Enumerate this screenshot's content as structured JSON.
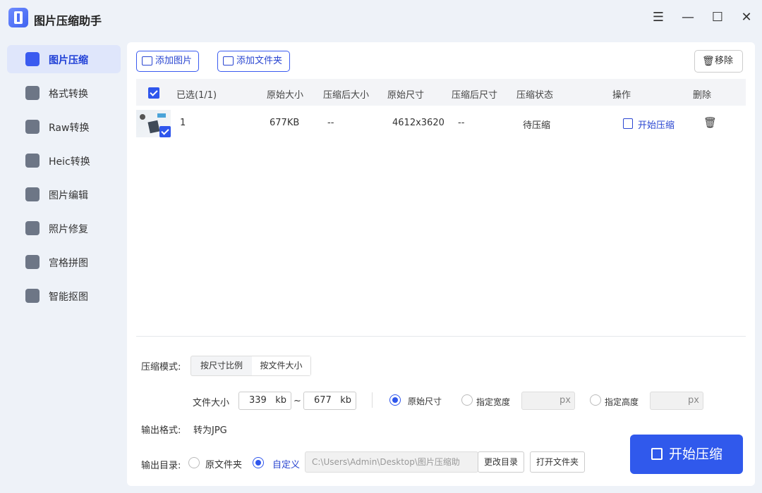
{
  "app": {
    "title": "图片压缩助手"
  },
  "sidebar": {
    "items": [
      {
        "label": "图片压缩"
      },
      {
        "label": "格式转换"
      },
      {
        "label": "Raw转换"
      },
      {
        "label": "Heic转换"
      },
      {
        "label": "图片编辑"
      },
      {
        "label": "照片修复"
      },
      {
        "label": "宫格拼图"
      },
      {
        "label": "智能抠图"
      }
    ]
  },
  "toolbar": {
    "add_image": "添加图片",
    "add_folder": "添加文件夹",
    "remove": "移除"
  },
  "table": {
    "headers": [
      "已选(1/1)",
      "原始大小",
      "压缩后大小",
      "原始尺寸",
      "压缩后尺寸",
      "压缩状态",
      "操作",
      "删除"
    ],
    "rows": [
      {
        "index": "1",
        "orig_size": "677KB",
        "comp_size": "--",
        "orig_dim": "4612x3620",
        "comp_dim": "--",
        "status": "待压缩",
        "action": "开始压缩"
      }
    ]
  },
  "settings": {
    "mode_label": "压缩模式:",
    "mode_options": [
      "按尺寸比例",
      "按文件大小"
    ],
    "filesize_label": "文件大小",
    "min_value": "339",
    "max_value": "677",
    "unit": "kb",
    "tilde": "~",
    "radio_original": "原始尺寸",
    "radio_width": "指定宽度",
    "radio_height": "指定高度",
    "px": "px",
    "format_label": "输出格式:",
    "format_value": "转为JPG",
    "dir_label": "输出目录:",
    "dir_original": "原文件夹",
    "dir_custom": "自定义",
    "path_value": "C:\\Users\\Admin\\Desktop\\图片压缩助",
    "change_dir": "更改目录",
    "open_folder": "打开文件夹",
    "start": "开始压缩"
  }
}
